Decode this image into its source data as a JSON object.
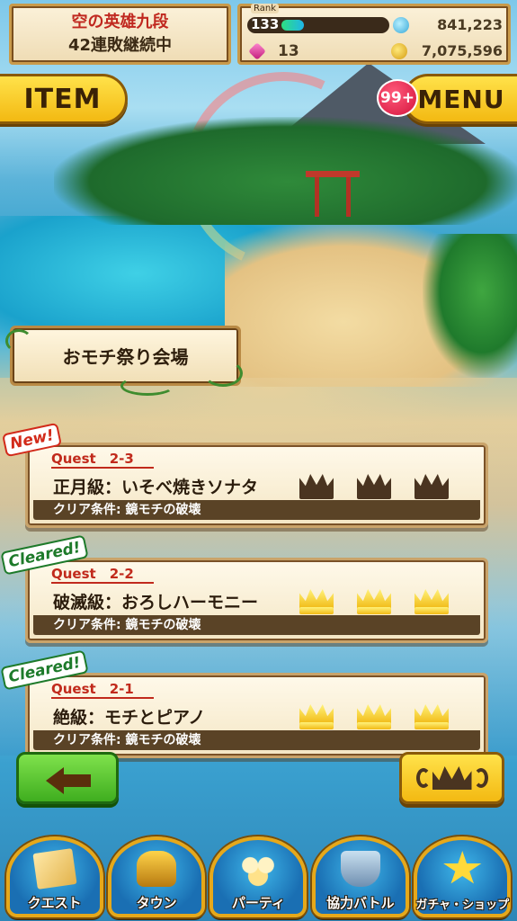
{
  "rank_title": {
    "line1": "空の英雄九段",
    "line2": "42連敗継続中"
  },
  "resources": {
    "rank_label": "Rank",
    "rank_value": "133",
    "rank_progress": 0.16,
    "exp_value": "841,223",
    "gem_value": "13",
    "coin_value": "7,075,596"
  },
  "top_buttons": {
    "item_label": "ITEM",
    "menu_label": "MENU",
    "menu_badge": "99+"
  },
  "location": {
    "name": "おモチ祭り会場"
  },
  "quests": [
    {
      "tag": "New!",
      "label": "Quest　2-3",
      "name": "正月級：いそべ焼きソナタ",
      "condition": "クリア条件: 鏡モチの破壊",
      "crowns_earned": 0,
      "crowns_total": 3
    },
    {
      "tag": "Cleared!",
      "label": "Quest　2-2",
      "name": "破滅級：おろしハーモニー",
      "condition": "クリア条件: 鏡モチの破壊",
      "crowns_earned": 3,
      "crowns_total": 3
    },
    {
      "tag": "Cleared!",
      "label": "Quest　2-1",
      "name": "絶級：モチとピアノ",
      "condition": "クリア条件: 鏡モチの破壊",
      "crowns_earned": 3,
      "crowns_total": 3
    }
  ],
  "nav": [
    {
      "label": "クエスト",
      "icon": "quest-map-icon"
    },
    {
      "label": "タウン",
      "icon": "town-ship-icon"
    },
    {
      "label": "パーティ",
      "icon": "party-icon"
    },
    {
      "label": "協力バトル",
      "icon": "coop-battle-icon"
    },
    {
      "label": "ガチャ・ショップ",
      "icon": "gacha-star-icon"
    }
  ],
  "colors": {
    "accent_yellow": "#f3b912",
    "quest_label_red": "#c12a1c",
    "cleared_green": "#1d7a2a",
    "back_green": "#3fae1f"
  }
}
